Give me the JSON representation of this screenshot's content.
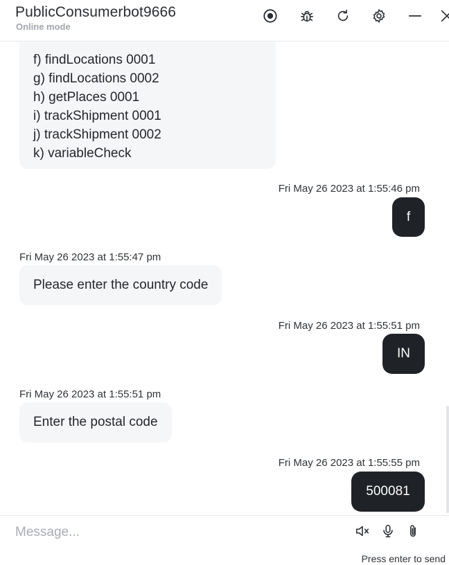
{
  "header": {
    "bot_name": "PublicConsumerbot9666",
    "status": "Online mode",
    "icons": [
      "record-icon",
      "bug-icon",
      "refresh-icon",
      "settings-icon",
      "minimize-icon",
      "close-icon"
    ]
  },
  "messages": {
    "bot_list": [
      "f) findLocations 0001",
      "g) findLocations 0002",
      "h) getPlaces 0001",
      "i) trackShipment 0001",
      "j) trackShipment 0002",
      "k) variableCheck"
    ],
    "m1": {
      "time": "Fri May 26 2023 at 1:55:46 pm",
      "text": "f"
    },
    "m2": {
      "time": "Fri May 26 2023 at 1:55:47 pm",
      "text": "Please enter the country code"
    },
    "m3": {
      "time": "Fri May 26 2023 at 1:55:51 pm",
      "text": "IN"
    },
    "m4": {
      "time": "Fri May 26 2023 at 1:55:51 pm",
      "text": "Enter the postal code"
    },
    "m5": {
      "time": "Fri May 26 2023 at 1:55:55 pm",
      "text": "500081"
    }
  },
  "composer": {
    "placeholder": "Message...",
    "hint": "Press enter to send",
    "icons": [
      "mute-icon",
      "microphone-icon",
      "attachment-icon"
    ]
  },
  "colors": {
    "user_bubble": "#1f2226",
    "bot_bubble": "#f5f6f8",
    "status_text": "#a1a6ad"
  }
}
